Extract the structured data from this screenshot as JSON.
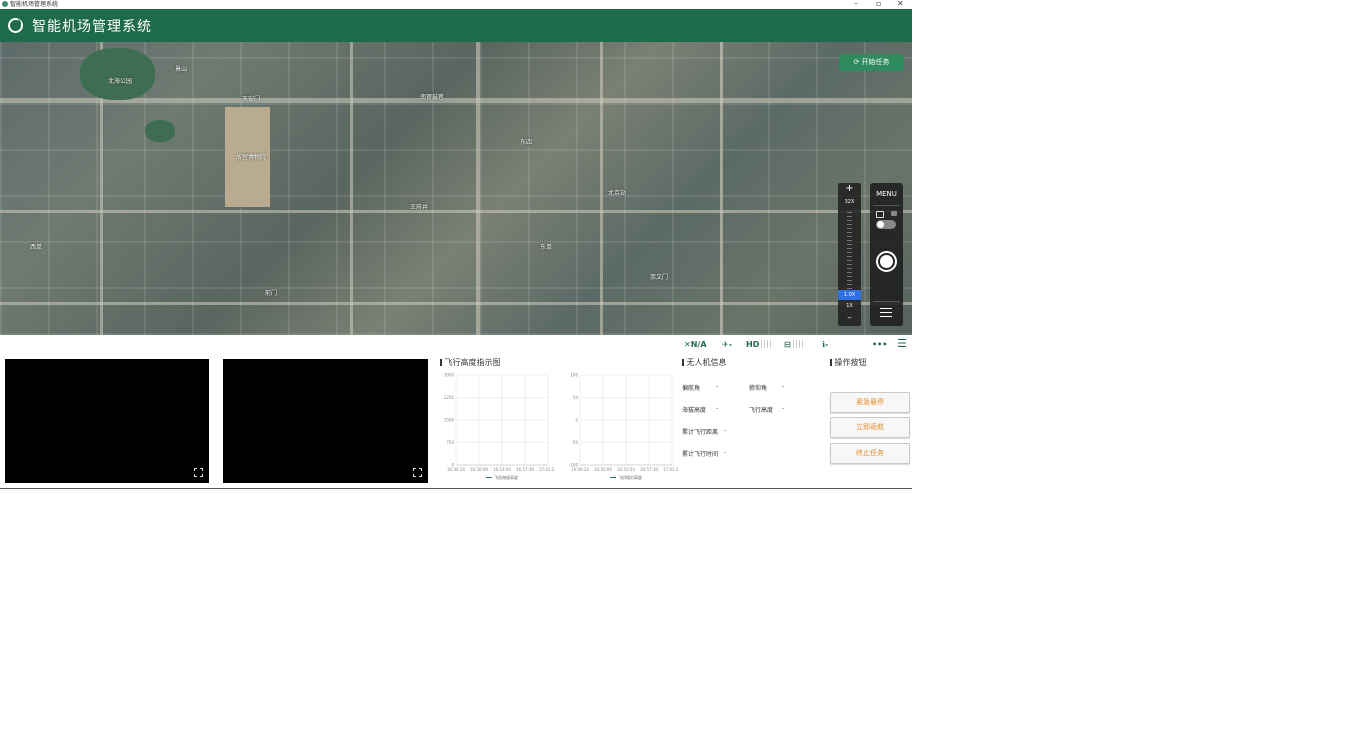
{
  "window": {
    "title": "智能机场管理系统",
    "controls": [
      "–",
      "▫",
      "✕"
    ]
  },
  "header": {
    "title": "智能机场管理系统"
  },
  "map": {
    "start_task_label": "开始任务",
    "labels": [
      "北海公园",
      "故宫博物院",
      "天安门",
      "北京站",
      "王府井",
      "前门",
      "东单",
      "崇文门",
      "景山",
      "南锣鼓巷",
      "西单",
      "东四"
    ],
    "zoom": {
      "plus": "+",
      "max_label": "32X",
      "current": "1.0X",
      "min_label": "1X",
      "minus": "–"
    },
    "camera_panel": {
      "menu_label": "MENU"
    }
  },
  "status_bar": {
    "signal_label": "N/A",
    "satellite_value": "-",
    "hd_label": "HD",
    "battery_value": "-",
    "link_value": "-",
    "more": "•••"
  },
  "panels": {
    "altitude_title": "飞行高度指示图",
    "drone_info_title": "无人机信息",
    "operations_title": "操作按钮"
  },
  "drone_info": {
    "heading": {
      "label": "偏航角",
      "value": "-"
    },
    "pitch": {
      "label": "俯仰角",
      "value": "-"
    },
    "altitude_sea": {
      "label": "海拔高度",
      "value": "-"
    },
    "altitude_flight": {
      "label": "飞行高度",
      "value": "-"
    },
    "total_distance": {
      "label": "累计飞行距离",
      "value": "-"
    },
    "total_time": {
      "label": "累计飞行时间",
      "value": "-"
    }
  },
  "buttons": {
    "emergency_hover": "紧急悬停",
    "return_home": "立即返航",
    "stop_task": "终止任务"
  },
  "colors": {
    "brand": "#1e6b4c",
    "button_text": "#e08a2a",
    "zoom_active": "#2e6ee6"
  },
  "chart_data": [
    {
      "type": "line",
      "title": "",
      "categories": [
        "16:46:24",
        "16:50:09",
        "16:53:54",
        "16:57:39",
        "17:01:24"
      ],
      "y_ticks": [
        "0",
        "750",
        "1500",
        "2250",
        "3000"
      ],
      "ylim": [
        0,
        3000
      ],
      "series": [
        {
          "name": "飞机海拔高度",
          "values": []
        }
      ],
      "grid": true,
      "legend": "bottom"
    },
    {
      "type": "line",
      "title": "",
      "categories": [
        "16:46:24",
        "16:50:09",
        "16:53:54",
        "16:57:39",
        "17:01:24"
      ],
      "y_ticks": [
        "-100",
        "-50",
        "0",
        "50",
        "100"
      ],
      "ylim": [
        -100,
        100
      ],
      "series": [
        {
          "name": "飞机相对高度",
          "values": []
        }
      ],
      "grid": true,
      "legend": "bottom"
    }
  ]
}
